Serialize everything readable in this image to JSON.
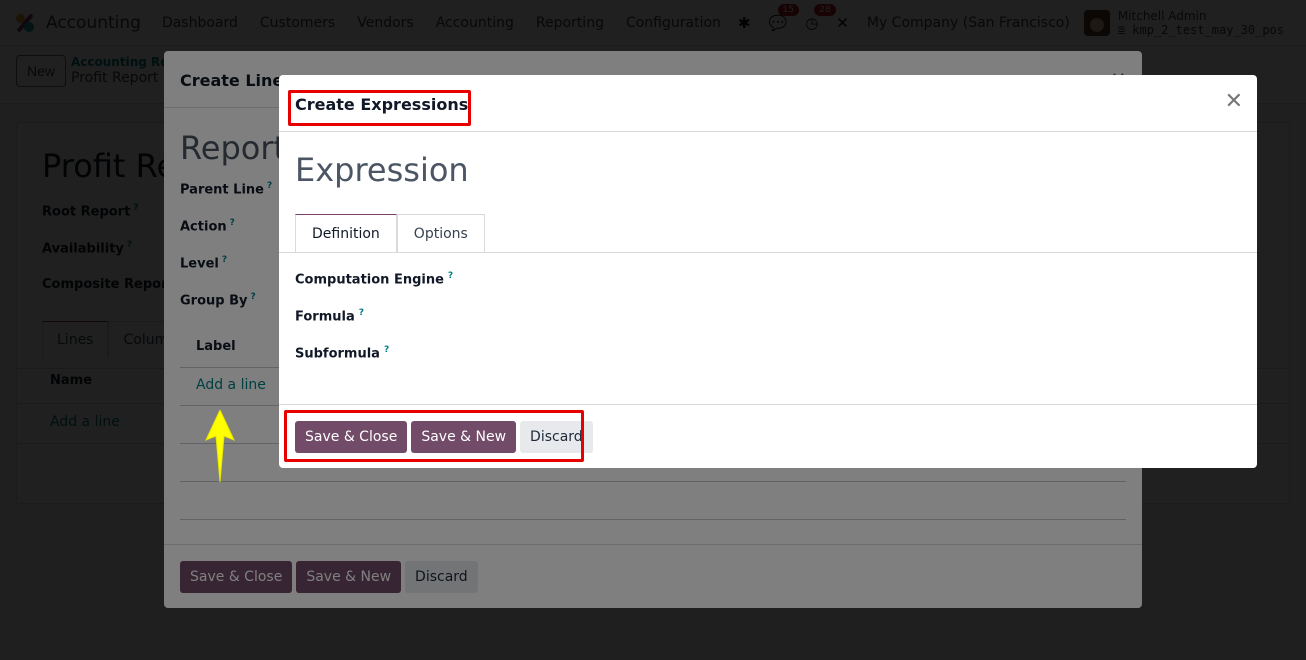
{
  "navbar": {
    "app_name": "Accounting",
    "menu": [
      "Dashboard",
      "Customers",
      "Vendors",
      "Accounting",
      "Reporting",
      "Configuration"
    ],
    "messages_count": "15",
    "activities_count": "28",
    "company": "My Company (San Francisco)",
    "user_name": "Mitchell Admin",
    "database": "kmp_2_test_may_30_pos"
  },
  "control_panel": {
    "new_label": "New",
    "breadcrumb_parent": "Accounting Rep",
    "breadcrumb_current": "Profit Report"
  },
  "sheet": {
    "title": "Profit Re",
    "fields": [
      "Root Report",
      "Availability",
      "Composite Report"
    ],
    "tabs": [
      "Lines",
      "Colum"
    ],
    "column_name": "Name",
    "add_line": "Add a line"
  },
  "lines_dialog": {
    "title": "Create Lines",
    "heading": "Report",
    "fields": [
      "Parent Line",
      "Action",
      "Level",
      "Group By"
    ],
    "column_label": "Label",
    "add_line": "Add a line",
    "save_close": "Save & Close",
    "save_new": "Save & New",
    "discard": "Discard"
  },
  "expressions_dialog": {
    "title": "Create Expressions",
    "heading": "Expression",
    "tabs": [
      {
        "label": "Definition",
        "active": true
      },
      {
        "label": "Options",
        "active": false
      }
    ],
    "fields": [
      "Computation Engine",
      "Formula",
      "Subformula"
    ],
    "help_mark": "?",
    "save_close": "Save & Close",
    "save_new": "Save & New",
    "discard": "Discard"
  },
  "colors": {
    "primary": "#714b67",
    "link": "#017e84",
    "highlight": "#e80000",
    "arrow": "#ffff00"
  }
}
